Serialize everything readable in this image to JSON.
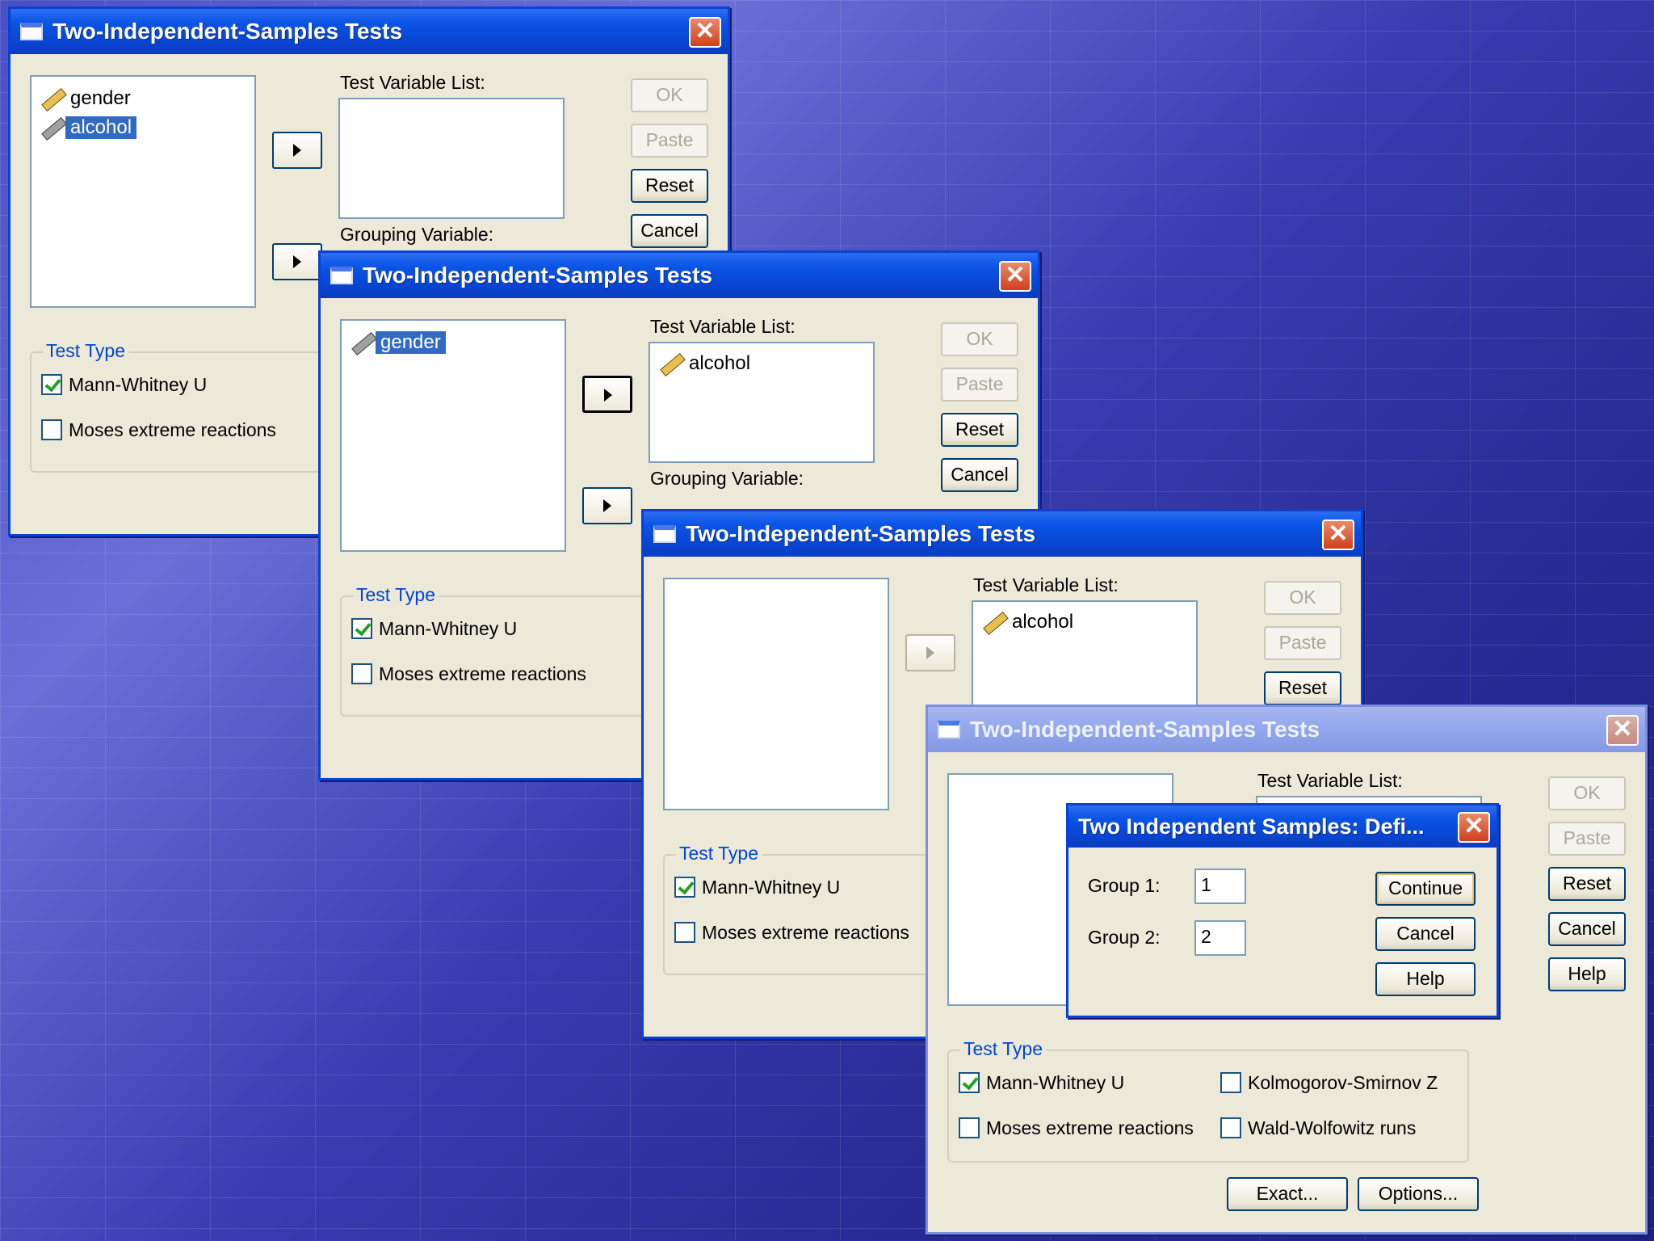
{
  "windows": {
    "w1": {
      "title": "Two-Independent-Samples Tests",
      "variables": [
        "gender",
        "alcohol"
      ],
      "test_variable_list_label": "Test Variable List:",
      "grouping_variable_label": "Grouping Variable:",
      "buttons": {
        "ok": "OK",
        "paste": "Paste",
        "reset": "Reset",
        "cancel": "Cancel"
      },
      "test_type_label": "Test Type",
      "mann_whitney": "Mann-Whitney U",
      "moses": "Moses extreme reactions"
    },
    "w2": {
      "title": "Two-Independent-Samples Tests",
      "variables": [
        "gender"
      ],
      "test_variable_list_label": "Test Variable List:",
      "test_variables": [
        "alcohol"
      ],
      "grouping_variable_label": "Grouping Variable:",
      "buttons": {
        "ok": "OK",
        "paste": "Paste",
        "reset": "Reset",
        "cancel": "Cancel"
      },
      "test_type_label": "Test Type",
      "mann_whitney": "Mann-Whitney U",
      "moses": "Moses extreme reactions"
    },
    "w3": {
      "title": "Two-Independent-Samples Tests",
      "test_variable_list_label": "Test Variable List:",
      "test_variables": [
        "alcohol"
      ],
      "buttons": {
        "ok": "OK",
        "paste": "Paste",
        "reset": "Reset"
      },
      "test_type_label": "Test Type",
      "mann_whitney": "Mann-Whitney U",
      "moses": "Moses extreme reactions"
    },
    "w4": {
      "title": "Two-Independent-Samples Tests",
      "test_variable_list_label": "Test Variable List:",
      "buttons": {
        "ok": "OK",
        "paste": "Paste",
        "reset": "Reset",
        "cancel": "Cancel",
        "help": "Help",
        "exact": "Exact...",
        "options": "Options..."
      },
      "test_type_label": "Test Type",
      "mann_whitney": "Mann-Whitney U",
      "kolmogorov": "Kolmogorov-Smirnov Z",
      "moses": "Moses extreme reactions",
      "wald": "Wald-Wolfowitz runs"
    },
    "define_groups": {
      "title": "Two Independent Samples: Defi...",
      "group1_label": "Group 1:",
      "group1_value": "1",
      "group2_label": "Group 2:",
      "group2_value": "2",
      "buttons": {
        "continue": "Continue",
        "cancel": "Cancel",
        "help": "Help"
      }
    }
  },
  "colors": {
    "xp_title_blue": "#0a54e6",
    "dialog_bg": "#ece9d8",
    "selection": "#316ac5",
    "group_label": "#0046d5"
  }
}
